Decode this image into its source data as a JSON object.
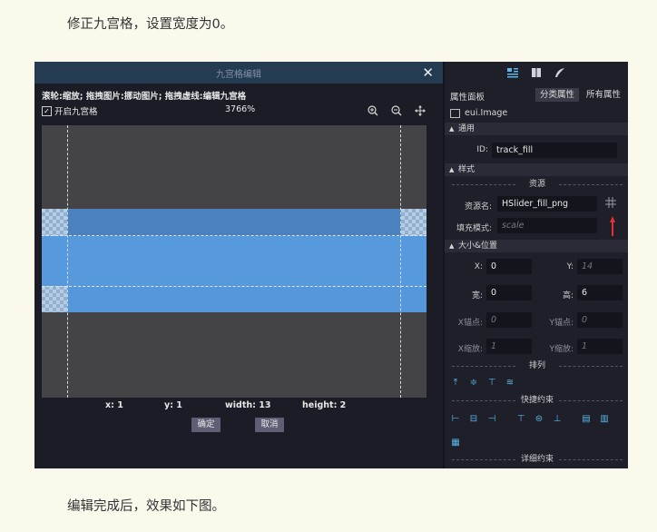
{
  "article": {
    "top_text": "修正九宫格，设置宽度为0。",
    "bottom_text": "编辑完成后，效果如下图。"
  },
  "dialog": {
    "title": "九宫格编辑",
    "close_symbol": "✕",
    "hint": "滚轮:缩放; 拖拽图片:挪动图片; 拖拽虚线:编辑九宫格",
    "checkbox_label": "开启九宫格",
    "checkbox_checked": true,
    "zoom": "3766%",
    "info": {
      "x": "x: 1",
      "y": "y: 1",
      "width": "width: 13",
      "height": "height: 2"
    },
    "ok_label": "确定",
    "cancel_label": "取消"
  },
  "panel": {
    "title": "属性面板",
    "tab_category": "分类属性",
    "tab_all": "所有属性",
    "component": "eui.Image",
    "sections": {
      "general": "通用",
      "style": "样式",
      "size_position": "大小&位置"
    },
    "id_label": "ID:",
    "id_value": "track_fill",
    "resource_subheader": "资源",
    "resource_name_label": "资源名:",
    "resource_name_value": "HSlider_fill_png",
    "fill_mode_label": "填充模式:",
    "fill_mode_value": "scale",
    "x_label": "X:",
    "x_value": "0",
    "y_label": "Y:",
    "y_value": "14",
    "w_label": "宽:",
    "w_value": "0",
    "h_label": "高:",
    "h_value": "6",
    "anchor_x_label": "X锚点:",
    "anchor_x_value": "0",
    "anchor_y_label": "Y锚点:",
    "anchor_y_value": "0",
    "scale_x_label": "X缩放:",
    "scale_x_value": "1",
    "scale_y_label": "Y缩放:",
    "scale_y_value": "1",
    "arrange_subheader": "排列",
    "constraint_subheader": "快捷约束",
    "detail_subheader": "详细约束"
  },
  "colors": {
    "page_bg": "#fbf8ec",
    "dialog_title_bg": "#243b52",
    "canvas_bg": "#444345",
    "slice_blue": "#5699dc",
    "panel_bg": "#1e1f29",
    "accent_icon": "#5ab7e8",
    "annotation_arrow": "#e23232"
  }
}
